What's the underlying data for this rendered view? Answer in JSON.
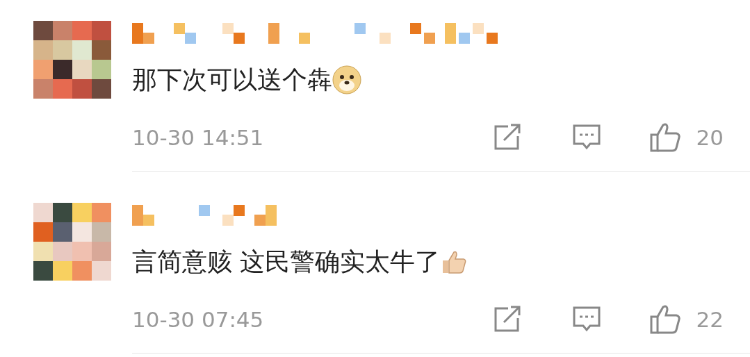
{
  "comments": [
    {
      "text": "那下次可以送个犇",
      "emoji": {
        "kind": "dog"
      },
      "time": "10-30 14:51",
      "likes": "20"
    },
    {
      "text": "言简意赅 这民警确实太牛了",
      "emoji": {
        "kind": "thumbs-up"
      },
      "time": "10-30 07:45",
      "likes": "22"
    }
  ]
}
